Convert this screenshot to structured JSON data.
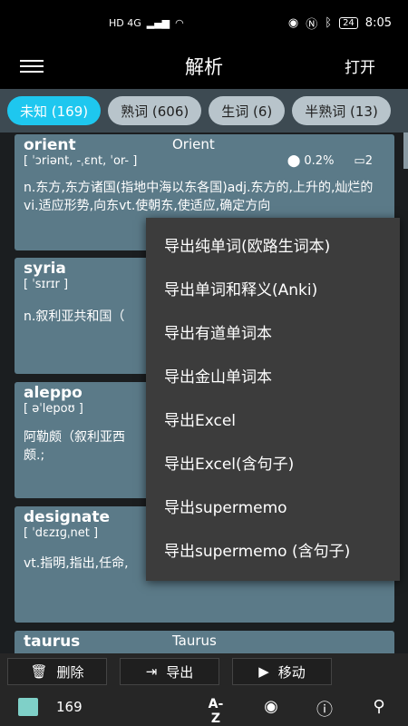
{
  "status": {
    "left_icons": "HD 4G",
    "time": "8:05",
    "battery": "24"
  },
  "header": {
    "title": "解析",
    "open_label": "打开"
  },
  "tabs": [
    {
      "label": "未知 (169)",
      "active": true
    },
    {
      "label": "熟词 (606)",
      "active": false
    },
    {
      "label": "生词 (6)",
      "active": false
    },
    {
      "label": "半熟词 (13)",
      "active": false
    }
  ],
  "cards": [
    {
      "word": "orient",
      "original": "Orient",
      "phonetic": "[ ˈɔriənt, -ˌɛnt, ˈor- ]",
      "freq": "0.2%",
      "count": "2",
      "definition": "n.东方,东方诸国(指地中海以东各国)adj.东方的,上升的,灿烂的vi.适应形势,向东vt.使朝东,使适应,确定方向"
    },
    {
      "word": "syria",
      "original": "",
      "phonetic": "[ ˈsɪrɪr ]",
      "freq": "",
      "count": "",
      "definition": "n.叙利亚共和国（"
    },
    {
      "word": "aleppo",
      "original": "",
      "phonetic": "[ əˈlepoʊ ]",
      "freq": "",
      "count": "",
      "definition": "阿勒颇（叙利亚西"
    },
    {
      "word": "designate",
      "original": "",
      "phonetic": "[ ˈdɛzɪɡˌnet ]",
      "freq": "",
      "count": "",
      "definition": "vt.指明,指出,任命,"
    },
    {
      "word": "taurus",
      "original": "Taurus",
      "phonetic": "",
      "freq": "",
      "count": "",
      "definition": ""
    }
  ],
  "card3_extra": "颇.;",
  "popup": {
    "items": [
      "导出纯单词(欧路生词本)",
      "导出单词和释义(Anki)",
      "导出有道单词本",
      "导出金山单词本",
      "导出Excel",
      "导出Excel(含句子)",
      "导出supermemo",
      "导出supermemo (含句子)"
    ]
  },
  "actions": {
    "delete_label": "删除",
    "export_label": "导出",
    "move_label": "移动"
  },
  "bottom": {
    "count": "169",
    "sort_icon": "A-Z"
  }
}
